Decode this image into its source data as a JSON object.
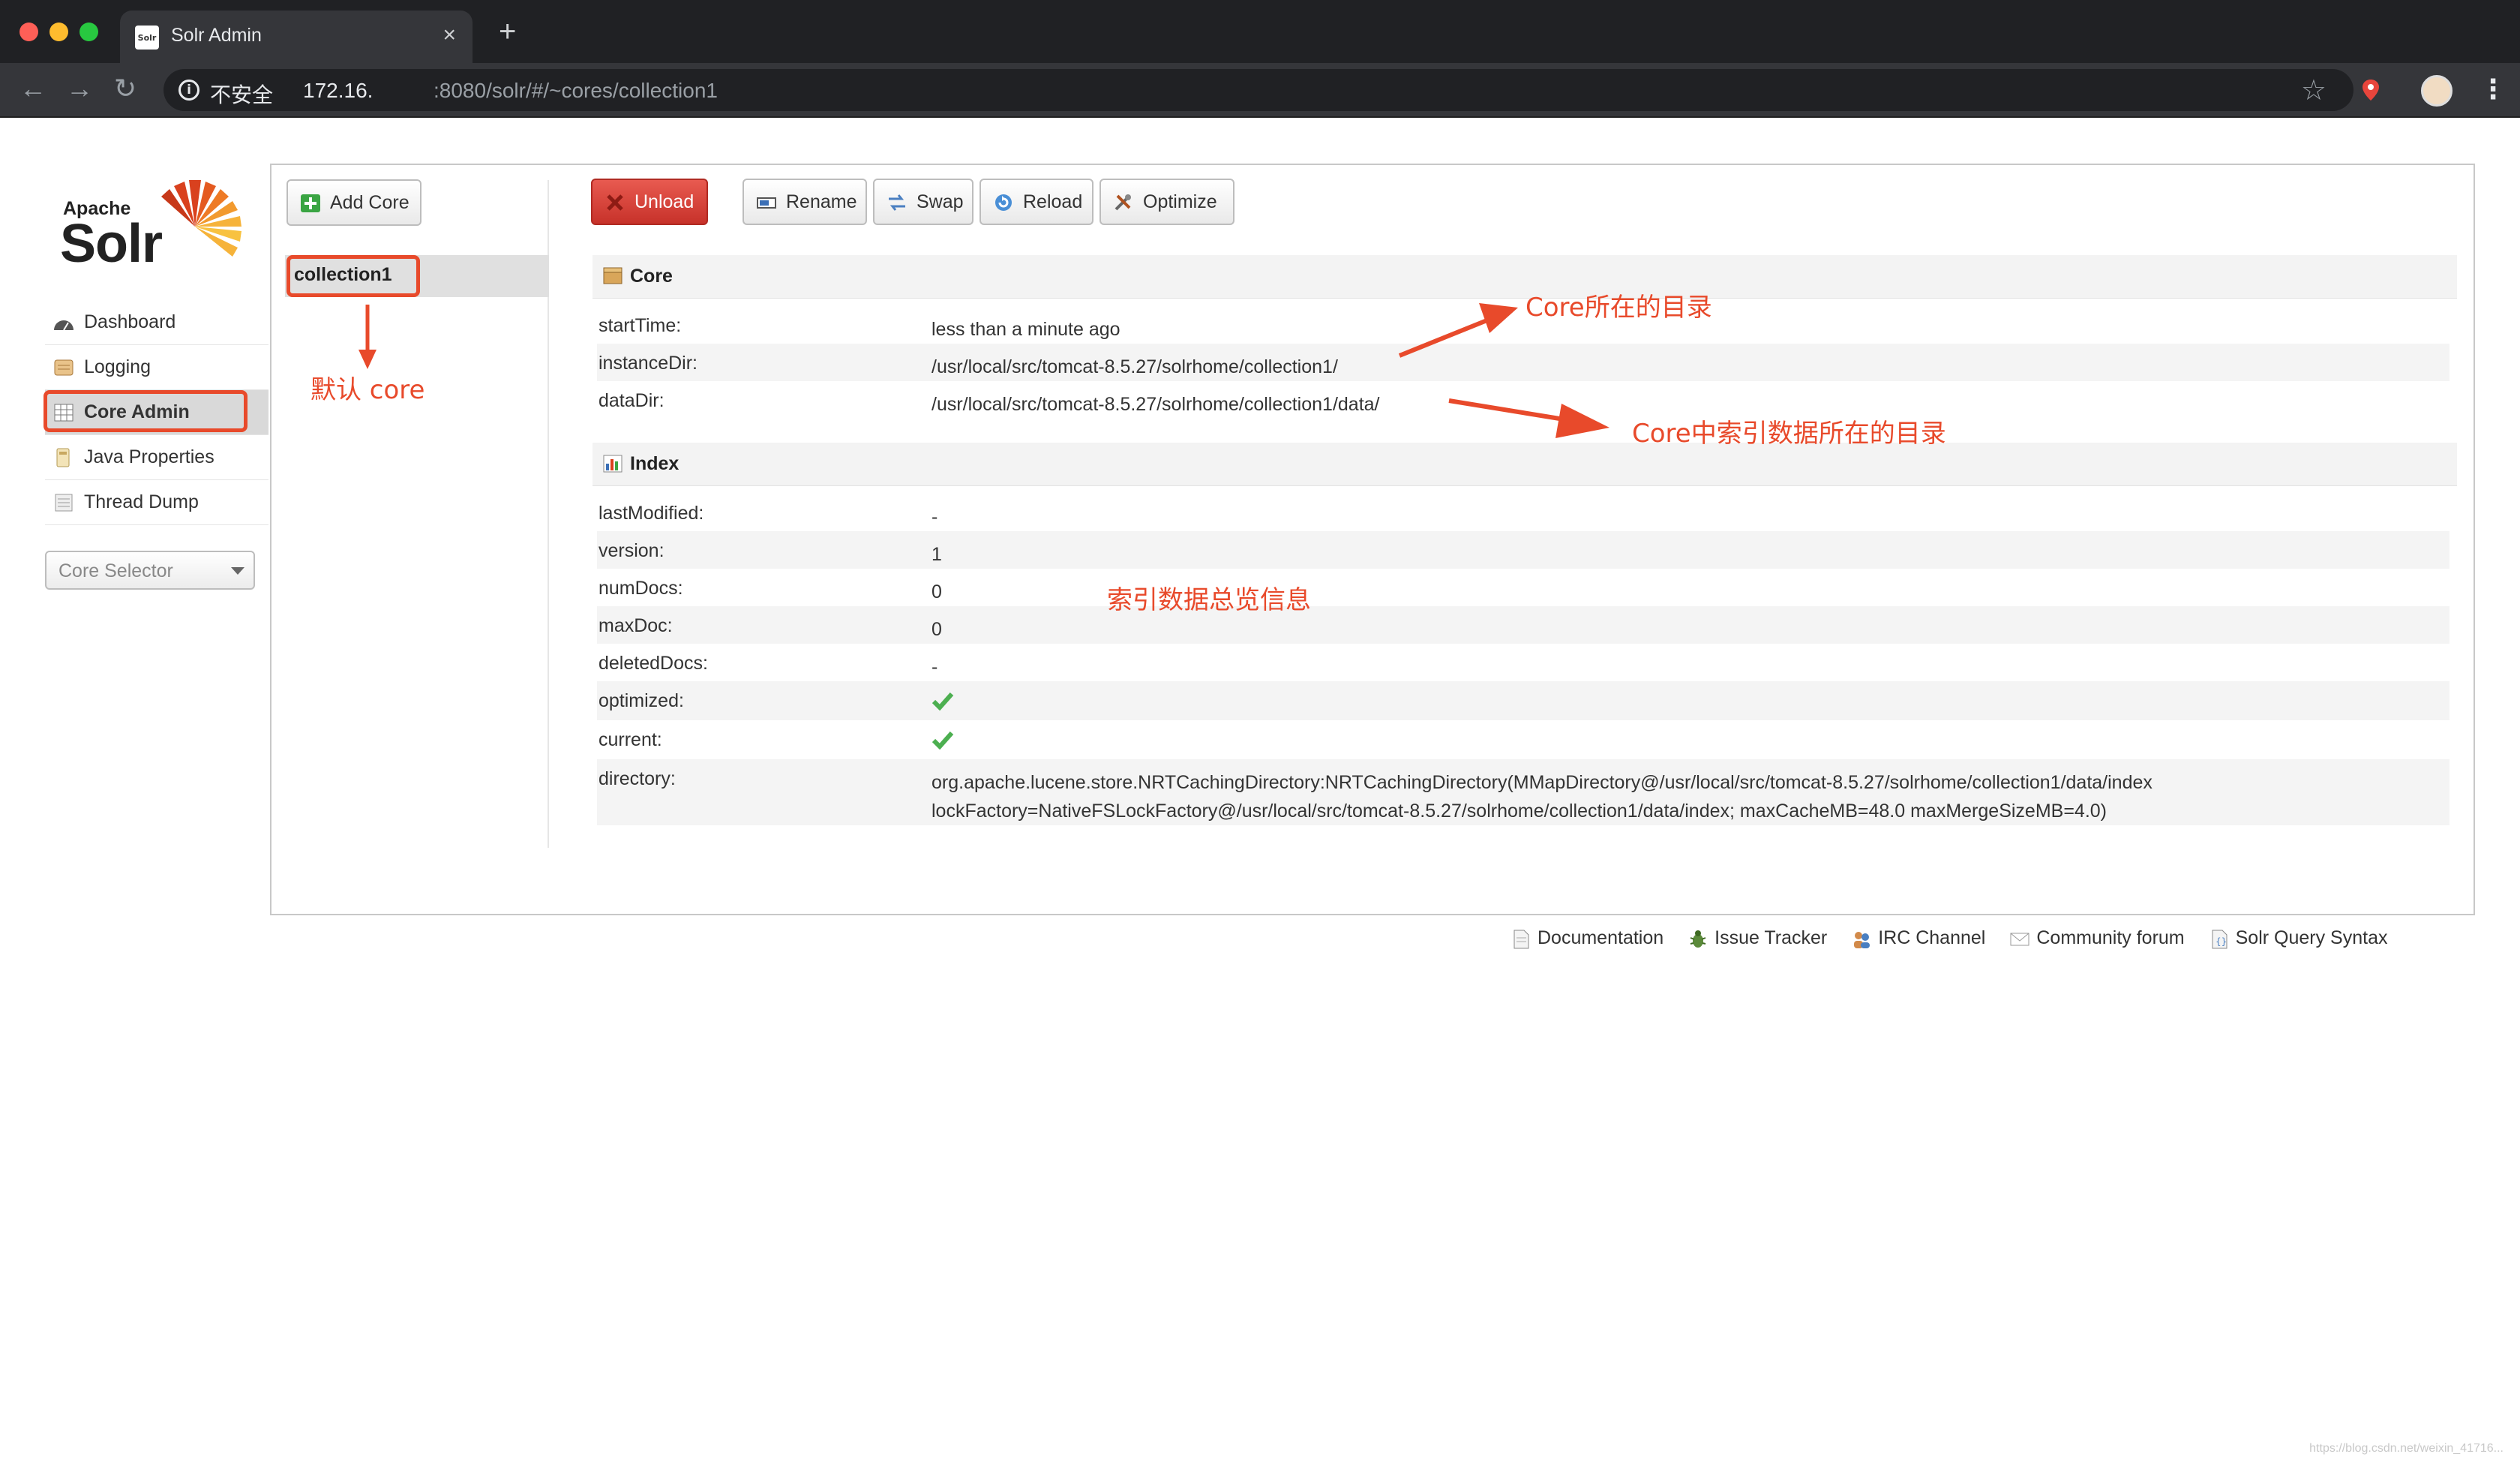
{
  "browser": {
    "tab_title": "Solr Admin",
    "favicon_text": "Solr",
    "insecure_label": "不安全",
    "url_host": "172.16.",
    "url_path": ":8080/solr/#/~cores/collection1"
  },
  "logo": {
    "apache": "Apache",
    "solr": "Solr"
  },
  "nav": {
    "items": [
      {
        "label": "Dashboard",
        "icon": "dashboard-icon"
      },
      {
        "label": "Logging",
        "icon": "logging-icon"
      },
      {
        "label": "Core Admin",
        "icon": "core-admin-icon",
        "active": true
      },
      {
        "label": "Java Properties",
        "icon": "java-properties-icon"
      },
      {
        "label": "Thread Dump",
        "icon": "thread-dump-icon"
      }
    ],
    "core_selector_placeholder": "Core Selector"
  },
  "toolbar": {
    "add_core": "Add Core",
    "unload": "Unload",
    "rename": "Rename",
    "swap": "Swap",
    "reload": "Reload",
    "optimize": "Optimize"
  },
  "cores": [
    "collection1"
  ],
  "core_section": {
    "title": "Core",
    "rows": [
      {
        "key": "startTime:",
        "value": "less than a minute ago"
      },
      {
        "key": "instanceDir:",
        "value": "/usr/local/src/tomcat-8.5.27/solrhome/collection1/"
      },
      {
        "key": "dataDir:",
        "value": "/usr/local/src/tomcat-8.5.27/solrhome/collection1/data/"
      }
    ]
  },
  "index_section": {
    "title": "Index",
    "rows": [
      {
        "key": "lastModified:",
        "value": "-"
      },
      {
        "key": "version:",
        "value": "1"
      },
      {
        "key": "numDocs:",
        "value": "0"
      },
      {
        "key": "maxDoc:",
        "value": "0"
      },
      {
        "key": "deletedDocs:",
        "value": "-"
      },
      {
        "key": "optimized:",
        "value": "",
        "check": true
      },
      {
        "key": "current:",
        "value": "",
        "check": true
      },
      {
        "key": "directory:",
        "value": "org.apache.lucene.store.NRTCachingDirectory:NRTCachingDirectory(MMapDirectory@/usr/local/src/tomcat-8.5.27/solrhome/collection1/data/index",
        "value2": "lockFactory=NativeFSLockFactory@/usr/local/src/tomcat-8.5.27/solrhome/collection1/data/index; maxCacheMB=48.0 maxMergeSizeMB=4.0)"
      }
    ]
  },
  "footer": {
    "links": [
      {
        "label": "Documentation",
        "icon": "documentation-icon"
      },
      {
        "label": "Issue Tracker",
        "icon": "bug-icon"
      },
      {
        "label": "IRC Channel",
        "icon": "irc-icon"
      },
      {
        "label": "Community forum",
        "icon": "mail-icon"
      },
      {
        "label": "Solr Query Syntax",
        "icon": "query-syntax-icon"
      }
    ]
  },
  "annotations": {
    "default_core": "默认 core",
    "core_dir": "Core所在的目录",
    "index_dir": "Core中索引数据所在的目录",
    "index_overview": "索引数据总览信息"
  },
  "colors": {
    "annotation": "#e84a2b",
    "unload": "#d23b30",
    "chrome_bg": "#202124"
  },
  "watermark": "https://blog.csdn.net/weixin_41716..."
}
